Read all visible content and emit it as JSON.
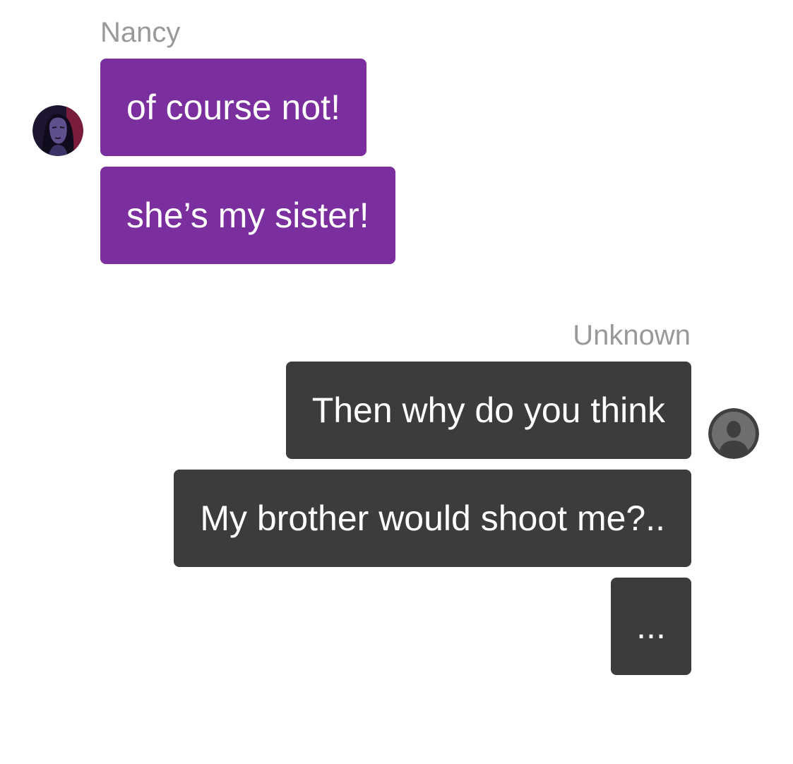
{
  "conversation": {
    "groups": [
      {
        "sender": "Nancy",
        "messages": [
          "of course not!",
          "she’s my sister!"
        ]
      },
      {
        "sender": "Unknown",
        "messages": [
          "Then why do you think",
          "My brother would shoot me?..",
          "..."
        ]
      }
    ]
  },
  "colors": {
    "nancy_bubble": "#7b2f9e",
    "unknown_bubble": "#3c3c3c",
    "sender_name": "#999999",
    "message_text": "#ffffff"
  },
  "icons": {
    "nancy_avatar": "illustrated-portrait-avatar",
    "unknown_avatar": "default-person-avatar-icon"
  }
}
